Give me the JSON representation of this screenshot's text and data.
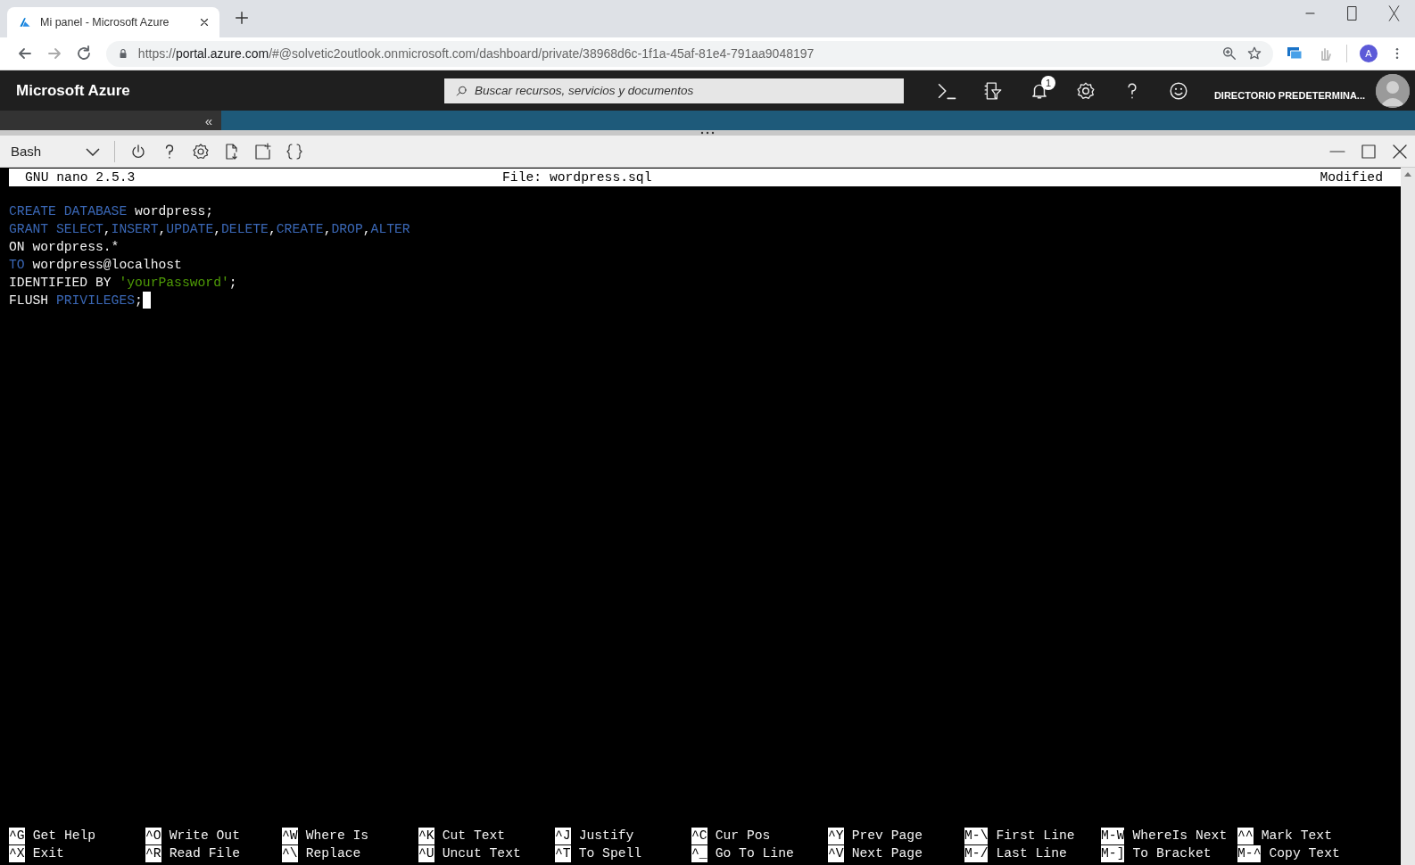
{
  "browser": {
    "tab": {
      "title": "Mi panel - Microsoft Azure",
      "selected": true
    },
    "url": {
      "scheme": "https://",
      "host": "portal.azure.com",
      "path": "/#@solvetic2outlook.onmicrosoft.com/dashboard/private/38968d6c-1f1a-45af-81e4-791aa9048197"
    },
    "profile_initial": "A"
  },
  "azure": {
    "title": "Microsoft Azure",
    "search": {
      "placeholder": "Buscar recursos, servicios y documentos"
    },
    "notification_count": "1",
    "directory": "DIRECTORIO PREDETERMINA...",
    "collapse": "«"
  },
  "shell": {
    "environment": "Bash"
  },
  "nano": {
    "version": "GNU nano 2.5.3",
    "file": "File: wordpress.sql",
    "status": "Modified"
  },
  "code": {
    "lines": [
      {
        "cursor": false,
        "segments": [
          {
            "text": "CREATE DATABASE",
            "kind": "keyword"
          },
          {
            "text": " wordpress;",
            "kind": "plain"
          }
        ]
      },
      {
        "cursor": false,
        "segments": [
          {
            "text": "GRANT SELECT",
            "kind": "keyword"
          },
          {
            "text": ",",
            "kind": "plain"
          },
          {
            "text": "INSERT",
            "kind": "keyword"
          },
          {
            "text": ",",
            "kind": "plain"
          },
          {
            "text": "UPDATE",
            "kind": "keyword"
          },
          {
            "text": ",",
            "kind": "plain"
          },
          {
            "text": "DELETE",
            "kind": "keyword"
          },
          {
            "text": ",",
            "kind": "plain"
          },
          {
            "text": "CREATE",
            "kind": "keyword"
          },
          {
            "text": ",",
            "kind": "plain"
          },
          {
            "text": "DROP",
            "kind": "keyword"
          },
          {
            "text": ",",
            "kind": "plain"
          },
          {
            "text": "ALTER",
            "kind": "keyword"
          }
        ]
      },
      {
        "cursor": false,
        "segments": [
          {
            "text": "ON wordpress.*",
            "kind": "plain"
          }
        ]
      },
      {
        "cursor": false,
        "segments": [
          {
            "text": "TO",
            "kind": "keyword"
          },
          {
            "text": " wordpress@localhost",
            "kind": "plain"
          }
        ]
      },
      {
        "cursor": false,
        "segments": [
          {
            "text": "IDENTIFIED BY ",
            "kind": "plain"
          },
          {
            "text": "'yourPassword'",
            "kind": "string"
          },
          {
            "text": ";",
            "kind": "plain"
          }
        ]
      },
      {
        "cursor": true,
        "segments": [
          {
            "text": "FLUSH ",
            "kind": "plain"
          },
          {
            "text": "PRIVILEGES",
            "kind": "keyword"
          },
          {
            "text": ";",
            "kind": "plain"
          }
        ]
      }
    ]
  },
  "shortcuts": [
    {
      "key": "^G",
      "label": "Get Help"
    },
    {
      "key": "^X",
      "label": "Exit"
    },
    {
      "key": "^O",
      "label": "Write Out"
    },
    {
      "key": "^R",
      "label": "Read File"
    },
    {
      "key": "^W",
      "label": "Where Is"
    },
    {
      "key": "^\\",
      "label": "Replace"
    },
    {
      "key": "^K",
      "label": "Cut Text"
    },
    {
      "key": "^U",
      "label": "Uncut Text"
    },
    {
      "key": "^J",
      "label": "Justify"
    },
    {
      "key": "^T",
      "label": "To Spell"
    },
    {
      "key": "^C",
      "label": "Cur Pos"
    },
    {
      "key": "^_",
      "label": "Go To Line"
    },
    {
      "key": "^Y",
      "label": "Prev Page"
    },
    {
      "key": "^V",
      "label": "Next Page"
    },
    {
      "key": "M-\\",
      "label": "First Line"
    },
    {
      "key": "M-/",
      "label": "Last Line"
    },
    {
      "key": "M-W",
      "label": "WhereIs Next"
    },
    {
      "key": "M-]",
      "label": "To Bracket"
    },
    {
      "key": "^^",
      "label": "Mark Text"
    },
    {
      "key": "M-^",
      "label": "Copy Text"
    }
  ]
}
